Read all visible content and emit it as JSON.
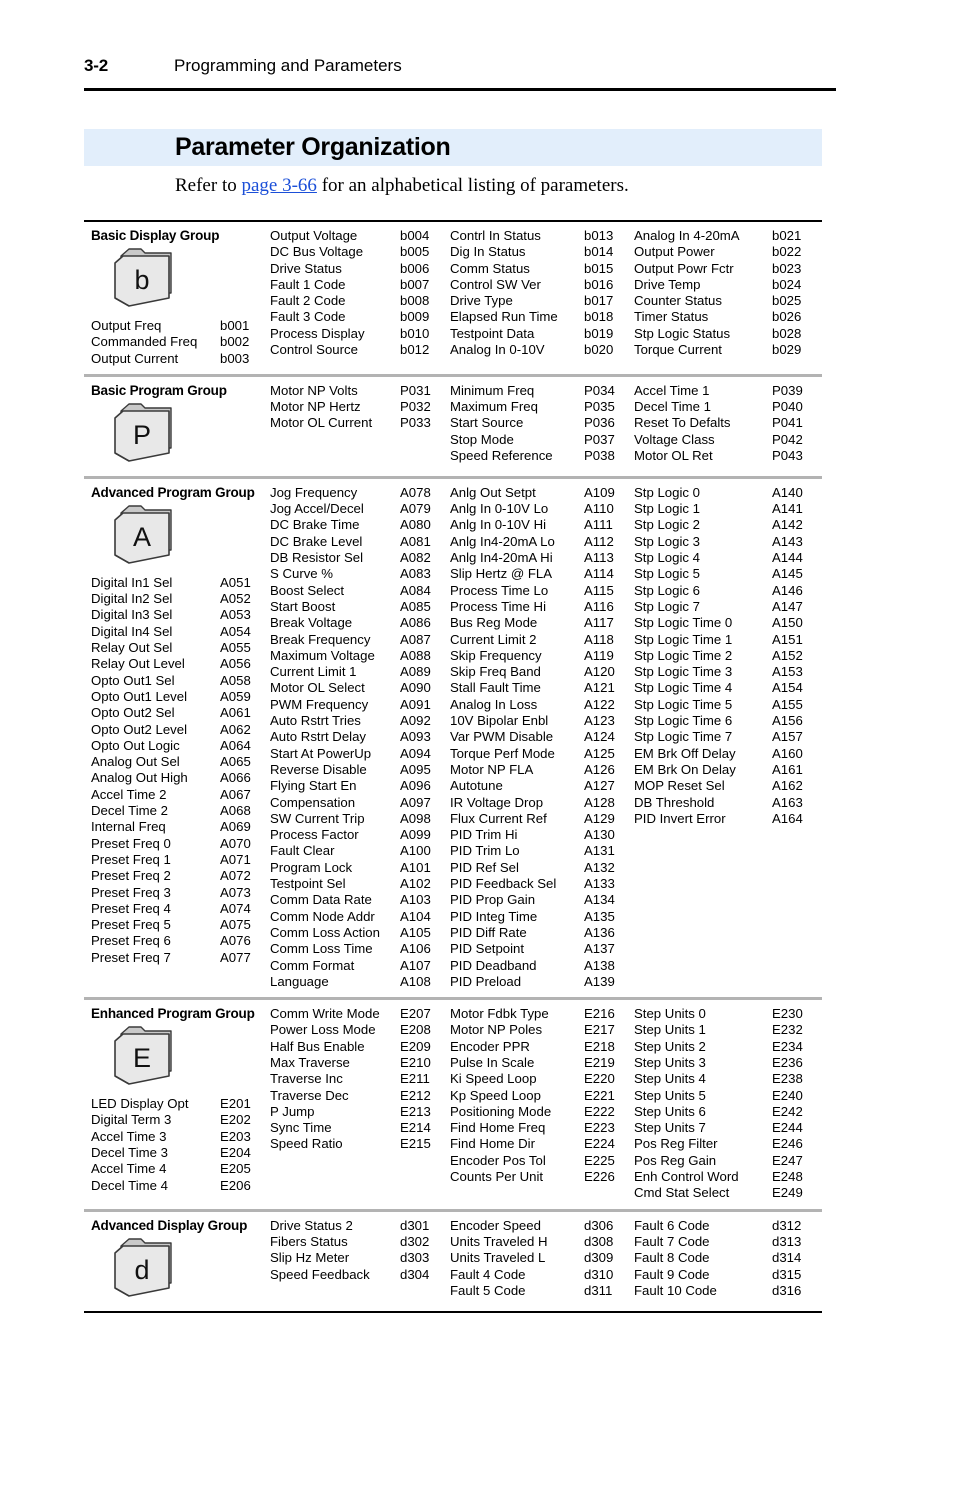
{
  "header": {
    "folio": "3-2",
    "chapter": "Programming and Parameters"
  },
  "title": "Parameter Organization",
  "intro": {
    "before": "Refer to ",
    "link": "page 3-66",
    "after": " for an alphabetical listing of parameters."
  },
  "colors": {
    "title_band": "#e2eefb",
    "link": "#1b4fd8",
    "divider": "#b3b3b3",
    "folder_face": "#e8e8e8",
    "folder_edge": "#3a3a3a"
  },
  "groups": [
    {
      "title": "Basic Display Group",
      "icon_letter": "b",
      "icon_name": "folder-icon-basic-display",
      "head_params": [
        {
          "name": "Output Freq",
          "code": "b001"
        },
        {
          "name": "Commanded Freq",
          "code": "b002"
        },
        {
          "name": "Output Current",
          "code": "b003"
        }
      ],
      "columns": [
        [
          {
            "name": "Output Voltage",
            "code": "b004"
          },
          {
            "name": "DC Bus Voltage",
            "code": "b005"
          },
          {
            "name": "Drive Status",
            "code": "b006"
          },
          {
            "name": "Fault 1 Code",
            "code": "b007"
          },
          {
            "name": "Fault 2 Code",
            "code": "b008"
          },
          {
            "name": "Fault 3 Code",
            "code": "b009"
          },
          {
            "name": "Process Display",
            "code": "b010"
          },
          {
            "name": "Control Source",
            "code": "b012"
          }
        ],
        [
          {
            "name": "Contrl In Status",
            "code": "b013"
          },
          {
            "name": "Dig In Status",
            "code": "b014"
          },
          {
            "name": "Comm Status",
            "code": "b015"
          },
          {
            "name": "Control SW Ver",
            "code": "b016"
          },
          {
            "name": "Drive Type",
            "code": "b017"
          },
          {
            "name": "Elapsed Run Time",
            "code": "b018"
          },
          {
            "name": "Testpoint Data",
            "code": "b019"
          },
          {
            "name": "Analog In 0-10V",
            "code": "b020"
          }
        ],
        [
          {
            "name": "Analog In 4-20mA",
            "code": "b021"
          },
          {
            "name": "Output Power",
            "code": "b022"
          },
          {
            "name": "Output Powr Fctr",
            "code": "b023"
          },
          {
            "name": "Drive Temp",
            "code": "b024"
          },
          {
            "name": "Counter Status",
            "code": "b025"
          },
          {
            "name": "Timer Status",
            "code": "b026"
          },
          {
            "name": "Stp Logic Status",
            "code": "b028"
          },
          {
            "name": "Torque Current",
            "code": "b029"
          }
        ]
      ]
    },
    {
      "title": "Basic Program Group",
      "icon_letter": "P",
      "icon_name": "folder-icon-basic-program",
      "head_params": [],
      "columns": [
        [
          {
            "name": "Motor NP Volts",
            "code": "P031"
          },
          {
            "name": "Motor NP Hertz",
            "code": "P032"
          },
          {
            "name": "Motor OL Current",
            "code": "P033"
          }
        ],
        [
          {
            "name": "Minimum Freq",
            "code": "P034"
          },
          {
            "name": "Maximum Freq",
            "code": "P035"
          },
          {
            "name": "Start Source",
            "code": "P036"
          },
          {
            "name": "Stop Mode",
            "code": "P037"
          },
          {
            "name": "Speed Reference",
            "code": "P038"
          }
        ],
        [
          {
            "name": "Accel Time 1",
            "code": "P039"
          },
          {
            "name": "Decel Time 1",
            "code": "P040"
          },
          {
            "name": "Reset To Defalts",
            "code": "P041"
          },
          {
            "name": "Voltage Class",
            "code": "P042"
          },
          {
            "name": "Motor OL Ret",
            "code": "P043"
          }
        ]
      ]
    },
    {
      "title": "Advanced Program Group",
      "icon_letter": "A",
      "icon_name": "folder-icon-advanced-program",
      "head_params": [
        {
          "name": "Digital In1 Sel",
          "code": "A051"
        },
        {
          "name": "Digital In2 Sel",
          "code": "A052"
        },
        {
          "name": "Digital In3 Sel",
          "code": "A053"
        },
        {
          "name": "Digital In4 Sel",
          "code": "A054"
        },
        {
          "name": "Relay Out Sel",
          "code": "A055"
        },
        {
          "name": "Relay Out Level",
          "code": "A056"
        },
        {
          "name": "Opto Out1 Sel",
          "code": "A058"
        },
        {
          "name": "Opto Out1 Level",
          "code": "A059"
        },
        {
          "name": "Opto Out2 Sel",
          "code": "A061"
        },
        {
          "name": "Opto Out2 Level",
          "code": "A062"
        },
        {
          "name": "Opto Out Logic",
          "code": "A064"
        },
        {
          "name": "Analog Out Sel",
          "code": "A065"
        },
        {
          "name": "Analog Out High",
          "code": "A066"
        },
        {
          "name": "Accel Time 2",
          "code": "A067"
        },
        {
          "name": "Decel Time 2",
          "code": "A068"
        },
        {
          "name": "Internal Freq",
          "code": "A069"
        },
        {
          "name": "Preset Freq 0",
          "code": "A070"
        },
        {
          "name": "Preset Freq 1",
          "code": "A071"
        },
        {
          "name": "Preset Freq 2",
          "code": "A072"
        },
        {
          "name": "Preset Freq 3",
          "code": "A073"
        },
        {
          "name": "Preset Freq 4",
          "code": "A074"
        },
        {
          "name": "Preset Freq 5",
          "code": "A075"
        },
        {
          "name": "Preset Freq 6",
          "code": "A076"
        },
        {
          "name": "Preset Freq 7",
          "code": "A077"
        }
      ],
      "columns": [
        [
          {
            "name": "Jog Frequency",
            "code": "A078"
          },
          {
            "name": "Jog Accel/Decel",
            "code": "A079"
          },
          {
            "name": "DC Brake Time",
            "code": "A080"
          },
          {
            "name": "DC Brake Level",
            "code": "A081"
          },
          {
            "name": "DB Resistor Sel",
            "code": "A082"
          },
          {
            "name": "S Curve %",
            "code": "A083"
          },
          {
            "name": "Boost Select",
            "code": "A084"
          },
          {
            "name": "Start Boost",
            "code": "A085"
          },
          {
            "name": "Break Voltage",
            "code": "A086"
          },
          {
            "name": "Break Frequency",
            "code": "A087"
          },
          {
            "name": "Maximum Voltage",
            "code": "A088"
          },
          {
            "name": "Current Limit 1",
            "code": "A089"
          },
          {
            "name": "Motor OL Select",
            "code": "A090"
          },
          {
            "name": "PWM Frequency",
            "code": "A091"
          },
          {
            "name": "Auto Rstrt Tries",
            "code": "A092"
          },
          {
            "name": "Auto Rstrt Delay",
            "code": "A093"
          },
          {
            "name": "Start At PowerUp",
            "code": "A094"
          },
          {
            "name": "Reverse Disable",
            "code": "A095"
          },
          {
            "name": "Flying Start En",
            "code": "A096"
          },
          {
            "name": "Compensation",
            "code": "A097"
          },
          {
            "name": "SW Current Trip",
            "code": "A098"
          },
          {
            "name": "Process Factor",
            "code": "A099"
          },
          {
            "name": "Fault Clear",
            "code": "A100"
          },
          {
            "name": "Program Lock",
            "code": "A101"
          },
          {
            "name": "Testpoint Sel",
            "code": "A102"
          },
          {
            "name": "Comm Data Rate",
            "code": "A103"
          },
          {
            "name": "Comm Node Addr",
            "code": "A104"
          },
          {
            "name": "Comm Loss Action",
            "code": "A105"
          },
          {
            "name": "Comm Loss Time",
            "code": "A106"
          },
          {
            "name": "Comm Format",
            "code": "A107"
          },
          {
            "name": "Language",
            "code": "A108"
          }
        ],
        [
          {
            "name": "Anlg Out Setpt",
            "code": "A109"
          },
          {
            "name": "Anlg In 0-10V Lo",
            "code": "A110"
          },
          {
            "name": "Anlg In 0-10V Hi",
            "code": "A111"
          },
          {
            "name": "Anlg In4-20mA Lo",
            "code": "A112"
          },
          {
            "name": "Anlg In4-20mA Hi",
            "code": "A113"
          },
          {
            "name": "Slip Hertz @ FLA",
            "code": "A114"
          },
          {
            "name": "Process Time Lo",
            "code": "A115"
          },
          {
            "name": "Process Time Hi",
            "code": "A116"
          },
          {
            "name": "Bus Reg Mode",
            "code": "A117"
          },
          {
            "name": "Current Limit 2",
            "code": "A118"
          },
          {
            "name": "Skip Frequency",
            "code": "A119"
          },
          {
            "name": "Skip Freq Band",
            "code": "A120"
          },
          {
            "name": "Stall Fault Time",
            "code": "A121"
          },
          {
            "name": "Analog In Loss",
            "code": "A122"
          },
          {
            "name": "10V Bipolar Enbl",
            "code": "A123"
          },
          {
            "name": "Var PWM Disable",
            "code": "A124"
          },
          {
            "name": "Torque Perf Mode",
            "code": "A125"
          },
          {
            "name": "Motor NP FLA",
            "code": "A126"
          },
          {
            "name": "Autotune",
            "code": "A127"
          },
          {
            "name": "IR Voltage Drop",
            "code": "A128"
          },
          {
            "name": "Flux Current Ref",
            "code": "A129"
          },
          {
            "name": "PID Trim Hi",
            "code": "A130"
          },
          {
            "name": "PID Trim Lo",
            "code": "A131"
          },
          {
            "name": "PID Ref Sel",
            "code": "A132"
          },
          {
            "name": "PID Feedback Sel",
            "code": "A133"
          },
          {
            "name": "PID Prop Gain",
            "code": "A134"
          },
          {
            "name": "PID Integ Time",
            "code": "A135"
          },
          {
            "name": "PID Diff Rate",
            "code": "A136"
          },
          {
            "name": "PID Setpoint",
            "code": "A137"
          },
          {
            "name": "PID Deadband",
            "code": "A138"
          },
          {
            "name": "PID Preload",
            "code": "A139"
          }
        ],
        [
          {
            "name": "Stp Logic 0",
            "code": "A140"
          },
          {
            "name": "Stp Logic 1",
            "code": "A141"
          },
          {
            "name": "Stp Logic 2",
            "code": "A142"
          },
          {
            "name": "Stp Logic 3",
            "code": "A143"
          },
          {
            "name": "Stp Logic 4",
            "code": "A144"
          },
          {
            "name": "Stp Logic 5",
            "code": "A145"
          },
          {
            "name": "Stp Logic 6",
            "code": "A146"
          },
          {
            "name": "Stp Logic 7",
            "code": "A147"
          },
          {
            "name": "Stp Logic Time 0",
            "code": "A150"
          },
          {
            "name": "Stp Logic Time 1",
            "code": "A151"
          },
          {
            "name": "Stp Logic Time 2",
            "code": "A152"
          },
          {
            "name": "Stp Logic Time 3",
            "code": "A153"
          },
          {
            "name": "Stp Logic Time 4",
            "code": "A154"
          },
          {
            "name": "Stp Logic Time 5",
            "code": "A155"
          },
          {
            "name": "Stp Logic Time 6",
            "code": "A156"
          },
          {
            "name": "Stp Logic Time 7",
            "code": "A157"
          },
          {
            "name": "EM Brk Off Delay",
            "code": "A160"
          },
          {
            "name": "EM Brk On Delay",
            "code": "A161"
          },
          {
            "name": "MOP Reset Sel",
            "code": "A162"
          },
          {
            "name": "DB Threshold",
            "code": "A163"
          },
          {
            "name": "PID Invert Error",
            "code": "A164"
          }
        ]
      ]
    },
    {
      "title": "Enhanced Program Group",
      "icon_letter": "E",
      "icon_name": "folder-icon-enhanced-program",
      "head_params": [
        {
          "name": "LED Display Opt",
          "code": "E201"
        },
        {
          "name": "Digital Term 3",
          "code": "E202"
        },
        {
          "name": "Accel Time 3",
          "code": "E203"
        },
        {
          "name": "Decel Time 3",
          "code": "E204"
        },
        {
          "name": "Accel Time 4",
          "code": "E205"
        },
        {
          "name": "Decel Time 4",
          "code": "E206"
        }
      ],
      "columns": [
        [
          {
            "name": "Comm Write Mode",
            "code": "E207"
          },
          {
            "name": "Power Loss Mode",
            "code": "E208"
          },
          {
            "name": "Half Bus Enable",
            "code": "E209"
          },
          {
            "name": "Max Traverse",
            "code": "E210"
          },
          {
            "name": "Traverse Inc",
            "code": "E211"
          },
          {
            "name": "Traverse Dec",
            "code": "E212"
          },
          {
            "name": "P Jump",
            "code": "E213"
          },
          {
            "name": "Sync Time",
            "code": "E214"
          },
          {
            "name": "Speed Ratio",
            "code": "E215"
          }
        ],
        [
          {
            "name": "Motor Fdbk Type",
            "code": "E216"
          },
          {
            "name": "Motor NP Poles",
            "code": "E217"
          },
          {
            "name": "Encoder PPR",
            "code": "E218"
          },
          {
            "name": "Pulse In Scale",
            "code": "E219"
          },
          {
            "name": "Ki Speed Loop",
            "code": "E220"
          },
          {
            "name": "Kp Speed Loop",
            "code": "E221"
          },
          {
            "name": "Positioning Mode",
            "code": "E222"
          },
          {
            "name": "Find Home Freq",
            "code": "E223"
          },
          {
            "name": "Find Home Dir",
            "code": "E224"
          },
          {
            "name": "Encoder Pos Tol",
            "code": "E225"
          },
          {
            "name": "Counts Per Unit",
            "code": "E226"
          }
        ],
        [
          {
            "name": "Step Units 0",
            "code": "E230"
          },
          {
            "name": "Step Units 1",
            "code": "E232"
          },
          {
            "name": "Step Units 2",
            "code": "E234"
          },
          {
            "name": "Step Units 3",
            "code": "E236"
          },
          {
            "name": "Step Units 4",
            "code": "E238"
          },
          {
            "name": "Step Units 5",
            "code": "E240"
          },
          {
            "name": "Step Units 6",
            "code": "E242"
          },
          {
            "name": "Step Units 7",
            "code": "E244"
          },
          {
            "name": "Pos Reg Filter",
            "code": "E246"
          },
          {
            "name": "Pos Reg Gain",
            "code": "E247"
          },
          {
            "name": "Enh Control Word",
            "code": "E248"
          },
          {
            "name": "Cmd Stat Select",
            "code": "E249"
          }
        ]
      ]
    },
    {
      "title": "Advanced Display Group",
      "icon_letter": "d",
      "icon_name": "folder-icon-advanced-display",
      "head_params": [],
      "columns": [
        [
          {
            "name": "Drive Status 2",
            "code": "d301"
          },
          {
            "name": "Fibers Status",
            "code": "d302"
          },
          {
            "name": "Slip Hz Meter",
            "code": "d303"
          },
          {
            "name": "Speed Feedback",
            "code": "d304"
          }
        ],
        [
          {
            "name": "Encoder Speed",
            "code": "d306"
          },
          {
            "name": "Units Traveled H",
            "code": "d308"
          },
          {
            "name": "Units Traveled L",
            "code": "d309"
          },
          {
            "name": "Fault 4 Code",
            "code": "d310"
          },
          {
            "name": "Fault 5 Code",
            "code": "d311"
          }
        ],
        [
          {
            "name": "Fault 6 Code",
            "code": "d312"
          },
          {
            "name": "Fault 7 Code",
            "code": "d313"
          },
          {
            "name": "Fault 8 Code",
            "code": "d314"
          },
          {
            "name": "Fault 9 Code",
            "code": "d315"
          },
          {
            "name": "Fault 10 Code",
            "code": "d316"
          }
        ]
      ]
    }
  ]
}
